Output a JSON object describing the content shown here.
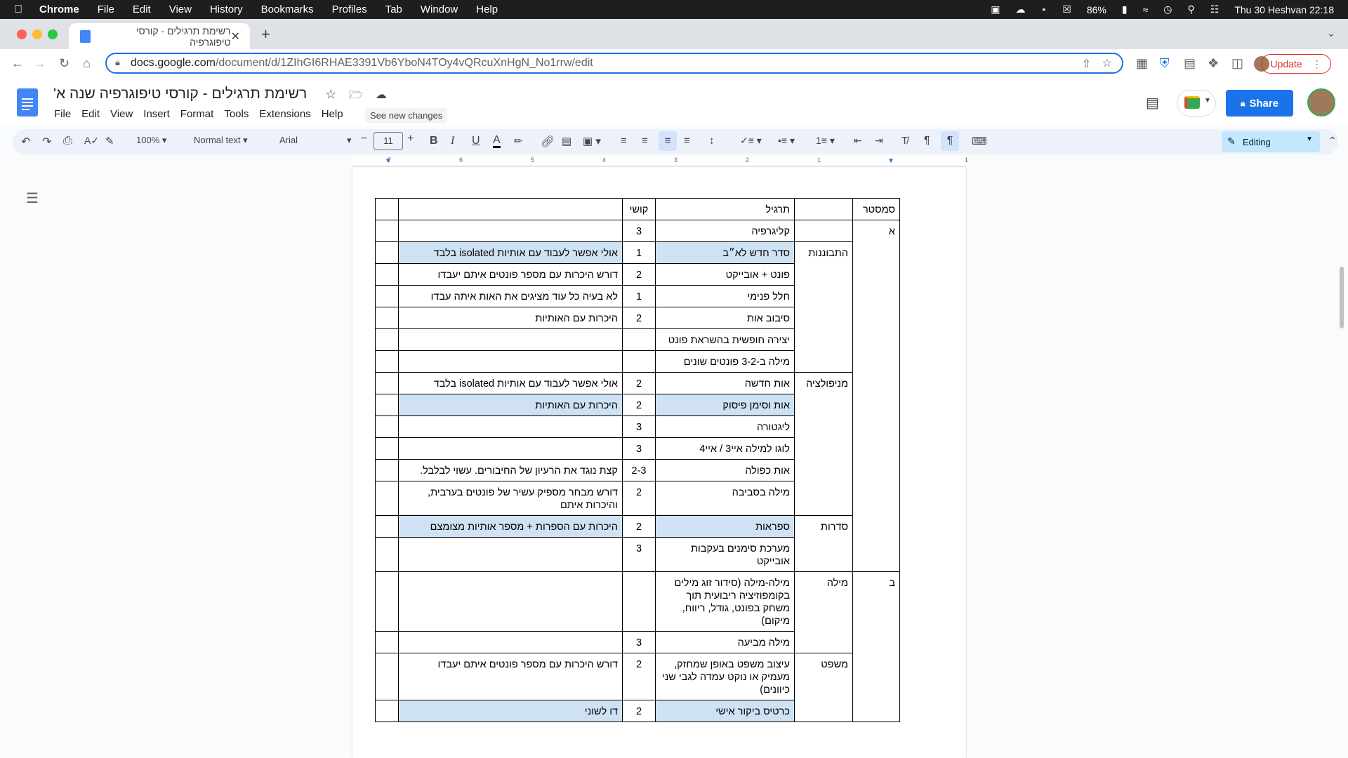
{
  "menubar": {
    "app": "Chrome",
    "items": [
      "File",
      "Edit",
      "View",
      "History",
      "Bookmarks",
      "Profiles",
      "Tab",
      "Window",
      "Help"
    ],
    "battery": "86%",
    "datetime": "Thu 30 Heshvan  22:18"
  },
  "browser": {
    "tab_title": "רשימת תרגילים - קורסי טיפוגרפיה",
    "url_host": "docs.google.com",
    "url_path": "/document/d/1ZIhGI6RHAE3391Vb6YboN4TOy4vQRcuXnHgN_No1rrw/edit",
    "update_label": "Update"
  },
  "docs": {
    "title": "רשימת תרגילים - קורסי טיפוגרפיה שנה א'",
    "menu": [
      "File",
      "Edit",
      "View",
      "Insert",
      "Format",
      "Tools",
      "Extensions",
      "Help"
    ],
    "see_new_changes": "See new changes",
    "share_label": "Share",
    "zoom": "100%",
    "style": "Normal text",
    "font": "Arial",
    "font_size": "11",
    "editing_label": "Editing",
    "ruler_numbers": [
      "7",
      "6",
      "5",
      "4",
      "3",
      "2",
      "1",
      "1"
    ]
  },
  "table": {
    "header": [
      "סמסטר",
      "",
      "תרגיל",
      "קושי",
      "",
      ""
    ],
    "rows": [
      {
        "sem": "א",
        "cat": "",
        "ex": "קליגרפיה",
        "diff": "3",
        "note": "",
        "hl": false
      },
      {
        "sem": "",
        "cat": "התבוננות",
        "ex": "סדר חדש לא״ב",
        "diff": "1",
        "note": "אולי אפשר לעבוד עם אותיות isolated בלבד",
        "hl": true
      },
      {
        "sem": "",
        "cat": "",
        "ex": "פונט + אובייקט",
        "diff": "2",
        "note": "דורש היכרות עם מספר פונטים איתם יעבדו",
        "hl": false
      },
      {
        "sem": "",
        "cat": "",
        "ex": "חלל פנימי",
        "diff": "1",
        "note": "לא בעיה כל עוד מציגים את האות איתה עבדו",
        "hl": false
      },
      {
        "sem": "",
        "cat": "",
        "ex": "סיבוב אות",
        "diff": "2",
        "note": "היכרות עם האותיות",
        "hl": false
      },
      {
        "sem": "",
        "cat": "",
        "ex": "יצירה חופשית בהשראת פונט",
        "diff": "",
        "note": "",
        "hl": false
      },
      {
        "sem": "",
        "cat": "",
        "ex": "מילה ב-3-2 פונטים שונים",
        "diff": "",
        "note": "",
        "hl": false
      },
      {
        "sem": "",
        "cat": "מניפולציה",
        "ex": "אות חדשה",
        "diff": "2",
        "note": "אולי אפשר לעבוד עם אותיות isolated בלבד",
        "hl": false
      },
      {
        "sem": "",
        "cat": "",
        "ex": "אות וסימן פיסוק",
        "diff": "2",
        "note": "היכרות עם האותיות",
        "hl": true
      },
      {
        "sem": "",
        "cat": "",
        "ex": "ליגטורה",
        "diff": "3",
        "note": "",
        "hl": false
      },
      {
        "sem": "",
        "cat": "",
        "ex": "לוגו למילה איי3 / איי4",
        "diff": "3",
        "note": "",
        "hl": false
      },
      {
        "sem": "",
        "cat": "",
        "ex": "אות כפולה",
        "diff": "2-3",
        "note": "קצת נוגד את הרעיון של החיבורים. עשוי לבלבל.",
        "hl": false
      },
      {
        "sem": "",
        "cat": "",
        "ex": "מילה בסביבה",
        "diff": "2",
        "note": "דורש מבחר מספיק עשיר של פונטים בערבית, והיכרות איתם",
        "hl": false
      },
      {
        "sem": "",
        "cat": "סדרות",
        "ex": "ספראות",
        "diff": "2",
        "note": "היכרות עם הספרות + מספר אותיות מצומצם",
        "hl": true
      },
      {
        "sem": "",
        "cat": "",
        "ex": "מערכת סימנים בעקבות אובייקט",
        "diff": "3",
        "note": "",
        "hl": false
      },
      {
        "sem": "ב",
        "cat": "מילה",
        "ex": "מילה-מילה (סידור זוג מילים בקומפוזיציה ריבועית תוך משחק בפונט, גודל, ריווח, מיקום)",
        "diff": "",
        "note": "",
        "hl": false
      },
      {
        "sem": "",
        "cat": "",
        "ex": "מילה מביעה",
        "diff": "3",
        "note": "",
        "hl": false
      },
      {
        "sem": "",
        "cat": "משפט",
        "ex": "עיצוב משפט באופן שמחזק, מעמיק או נוקט עמדה לגבי שני כיוונים)",
        "diff": "2",
        "note": "דורש היכרות עם מספר פונטים איתם יעבדו",
        "hl": false
      },
      {
        "sem": "",
        "cat": "",
        "ex": "כרטיס ביקור אישי",
        "diff": "2",
        "note": "דו לשוני",
        "hl": true
      }
    ]
  }
}
